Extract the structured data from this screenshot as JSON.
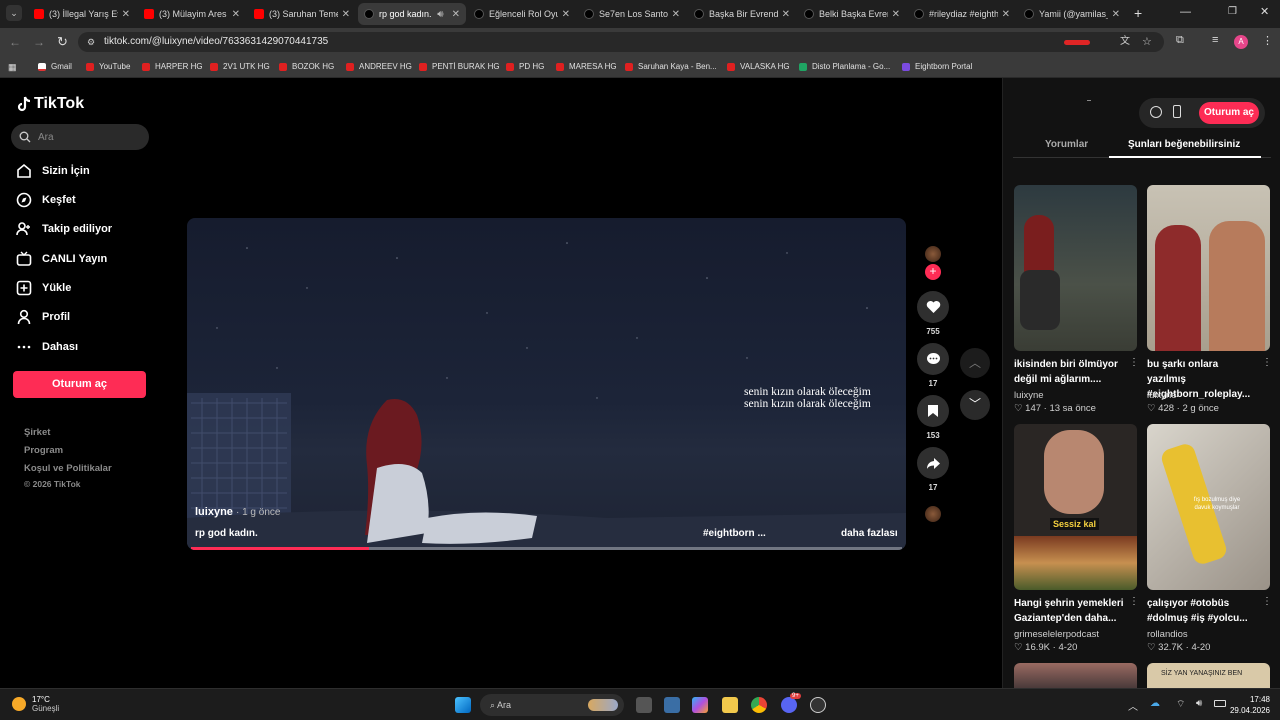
{
  "browser": {
    "tabs": [
      {
        "title": "(3) İllegal Yarış Eti",
        "icon": "youtube-icon"
      },
      {
        "title": "(3) Mülayim Ares",
        "icon": "youtube-icon"
      },
      {
        "title": "(3) Saruhan Teme",
        "icon": "youtube-icon"
      },
      {
        "title": "rp god kadın.",
        "icon": "tiktok-icon",
        "active": true
      },
      {
        "title": "Eğlenceli Rol Oyu",
        "icon": "tiktok-icon"
      },
      {
        "title": "Se7en Los Santos",
        "icon": "tiktok-icon"
      },
      {
        "title": "Başka Bir Evrende",
        "icon": "tiktok-icon"
      },
      {
        "title": "Belki Başka Evren",
        "icon": "tiktok-icon"
      },
      {
        "title": "#rileydiaz #eighth",
        "icon": "tiktok-icon"
      },
      {
        "title": "Yamii (@yamilas_",
        "icon": "tiktok-icon"
      }
    ],
    "url": "tiktok.com/@luixyne/video/7633631429070441735",
    "bookmarks": [
      "Gmail",
      "YouTube",
      "HARPER HG",
      "2V1 UTK HG",
      "BOZOK HG",
      "ANDREEV HG",
      "PENTİ BURAK HG",
      "PD HG",
      "MARESA HG",
      "Saruhan Kaya - Ben...",
      "VALASKA HG",
      "Disto Planlama - Go...",
      "Eightborn Portal"
    ],
    "profile_initial": "A"
  },
  "sidebar": {
    "logo": "TikTok",
    "search_placeholder": "Ara",
    "nav": [
      "Sizin İçin",
      "Keşfet",
      "Takip ediliyor",
      "CANLI Yayın",
      "Yükle",
      "Profil",
      "Dahası"
    ],
    "login_button": "Oturum aç",
    "footer": [
      "Şirket",
      "Program",
      "Koşul ve Politikalar"
    ],
    "copyright": "© 2026 TikTok"
  },
  "video": {
    "caption_text_1": "senin kızın olarak öleceğim",
    "caption_text_2": "senin kızın olarak öleceğim",
    "author": "luixyne",
    "age": "· 1 g önce",
    "description": "rp god kadın.",
    "hashtag": "#eightborn ...",
    "more": "daha fazlası",
    "progress": 0.25
  },
  "actions": {
    "likes": "755",
    "comments": "17",
    "saves": "153",
    "shares": "17"
  },
  "right_panel": {
    "login_button": "Oturum aç",
    "tabs": [
      "Yorumlar",
      "Şunları beğenebilirsiniz"
    ],
    "active_tab": 1,
    "cards": [
      {
        "title": "ikisinden biri ölmüyor değil mi ağlarım....",
        "author": "luixyne",
        "likes": "147",
        "age": "13 sa önce"
      },
      {
        "title": "bu şarkı onlara yazılmış #eightborn_roleplay...",
        "author": "luixyne",
        "likes": "428",
        "age": "2 g önce"
      },
      {
        "title": "Hangi şehrin yemekleri Gaziantep'den daha...",
        "author": "grimeselelerpodcast",
        "likes": "16.9K",
        "age": "4-20",
        "overlay": "Sessiz kal"
      },
      {
        "title": "çalışıyor #otobüs #dolmuş #iş #yolcu...",
        "author": "rollandios",
        "likes": "32.7K",
        "age": "4-20",
        "overlay": "fış bozulmuş diye davuk koymuşlar"
      }
    ],
    "bottom_overlay": "SİZ YAN YANAŞINIZ BEN"
  },
  "taskbar": {
    "weather_temp": "17°C",
    "weather_desc": "Güneşli",
    "search": "Ara",
    "time": "17:48",
    "date": "29.04.2026",
    "badge": "9+"
  },
  "colors": {
    "accent": "#fe2c55",
    "bg": "#000000",
    "panel": "#121212"
  }
}
